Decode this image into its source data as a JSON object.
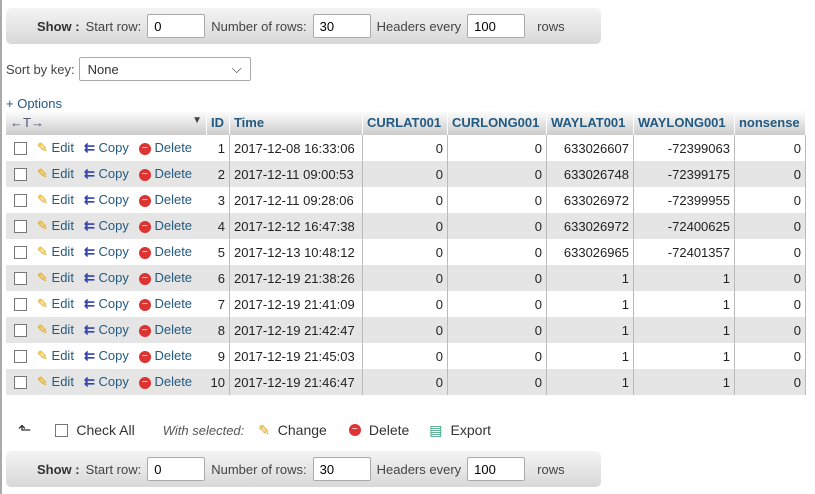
{
  "nav": {
    "show": "Show :",
    "start_label": "Start row:",
    "start": "0",
    "rows_label": "Number of rows:",
    "rows": "30",
    "headers_label": "Headers every",
    "headers": "100",
    "rows_suffix": "rows"
  },
  "sort": {
    "label": "Sort by key:",
    "value": "None"
  },
  "options": "+ Options",
  "columns": [
    "ID",
    "Time",
    "CURLAT001",
    "CURLONG001",
    "WAYLAT001",
    "WAYLONG001",
    "nonsense"
  ],
  "actions": {
    "edit": "Edit",
    "copy": "Copy",
    "delete": "Delete"
  },
  "rows": [
    [
      "1",
      "2017-12-08 16:33:06",
      "0",
      "0",
      "633026607",
      "-72399063",
      "0"
    ],
    [
      "2",
      "2017-12-11 09:00:53",
      "0",
      "0",
      "633026748",
      "-72399175",
      "0"
    ],
    [
      "3",
      "2017-12-11 09:28:06",
      "0",
      "0",
      "633026972",
      "-72399955",
      "0"
    ],
    [
      "4",
      "2017-12-12 16:47:38",
      "0",
      "0",
      "633026972",
      "-72400625",
      "0"
    ],
    [
      "5",
      "2017-12-13 10:48:12",
      "0",
      "0",
      "633026965",
      "-72401357",
      "0"
    ],
    [
      "6",
      "2017-12-19 21:38:26",
      "0",
      "0",
      "1",
      "1",
      "0"
    ],
    [
      "7",
      "2017-12-19 21:41:09",
      "0",
      "0",
      "1",
      "1",
      "0"
    ],
    [
      "8",
      "2017-12-19 21:42:47",
      "0",
      "0",
      "1",
      "1",
      "0"
    ],
    [
      "9",
      "2017-12-19 21:45:03",
      "0",
      "0",
      "1",
      "1",
      "0"
    ],
    [
      "10",
      "2017-12-19 21:46:47",
      "0",
      "0",
      "1",
      "1",
      "0"
    ]
  ],
  "bottom": {
    "check_all": "Check All",
    "with_selected": "With selected:",
    "change": "Change",
    "delete": "Delete",
    "export": "Export"
  }
}
